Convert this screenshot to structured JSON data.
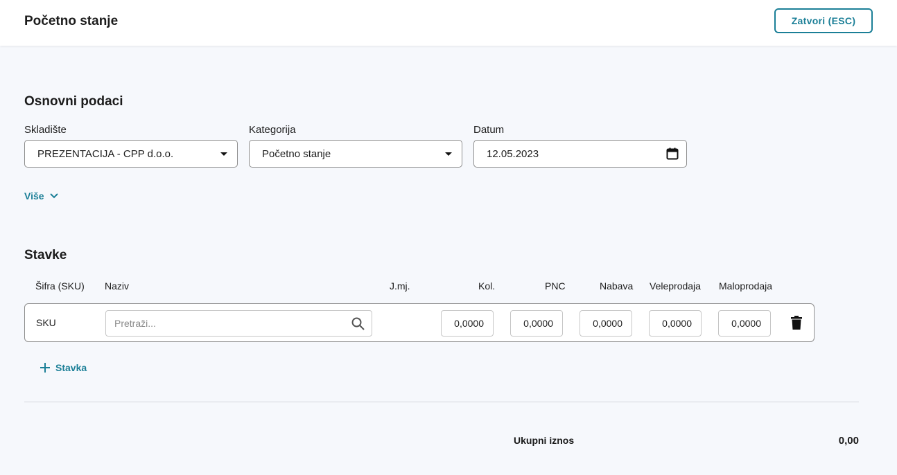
{
  "header": {
    "title": "Početno stanje",
    "close_label": "Zatvori (ESC)"
  },
  "basic": {
    "title": "Osnovni podaci",
    "warehouse": {
      "label": "Skladište",
      "value": "PREZENTACIJA - CPP d.o.o."
    },
    "category": {
      "label": "Kategorija",
      "value": "Početno stanje"
    },
    "date": {
      "label": "Datum",
      "value": "12.05.2023"
    },
    "more_label": "Više"
  },
  "items": {
    "title": "Stavke",
    "columns": [
      "Šifra (SKU)",
      "Naziv",
      "J.mj.",
      "Kol.",
      "PNC",
      "Nabava",
      "Veleprodaja",
      "Maloprodaja"
    ],
    "row": {
      "sku": "SKU",
      "search_placeholder": "Pretraži...",
      "kol": "0,0000",
      "pnc": "0,0000",
      "nabava": "0,0000",
      "veleprodaja": "0,0000",
      "maloprodaja": "0,0000"
    },
    "add_label": "Stavka"
  },
  "totals": {
    "label": "Ukupni iznos",
    "value": "0,00"
  },
  "colors": {
    "accent": "#1b7f97",
    "background": "#f6f8fc"
  }
}
